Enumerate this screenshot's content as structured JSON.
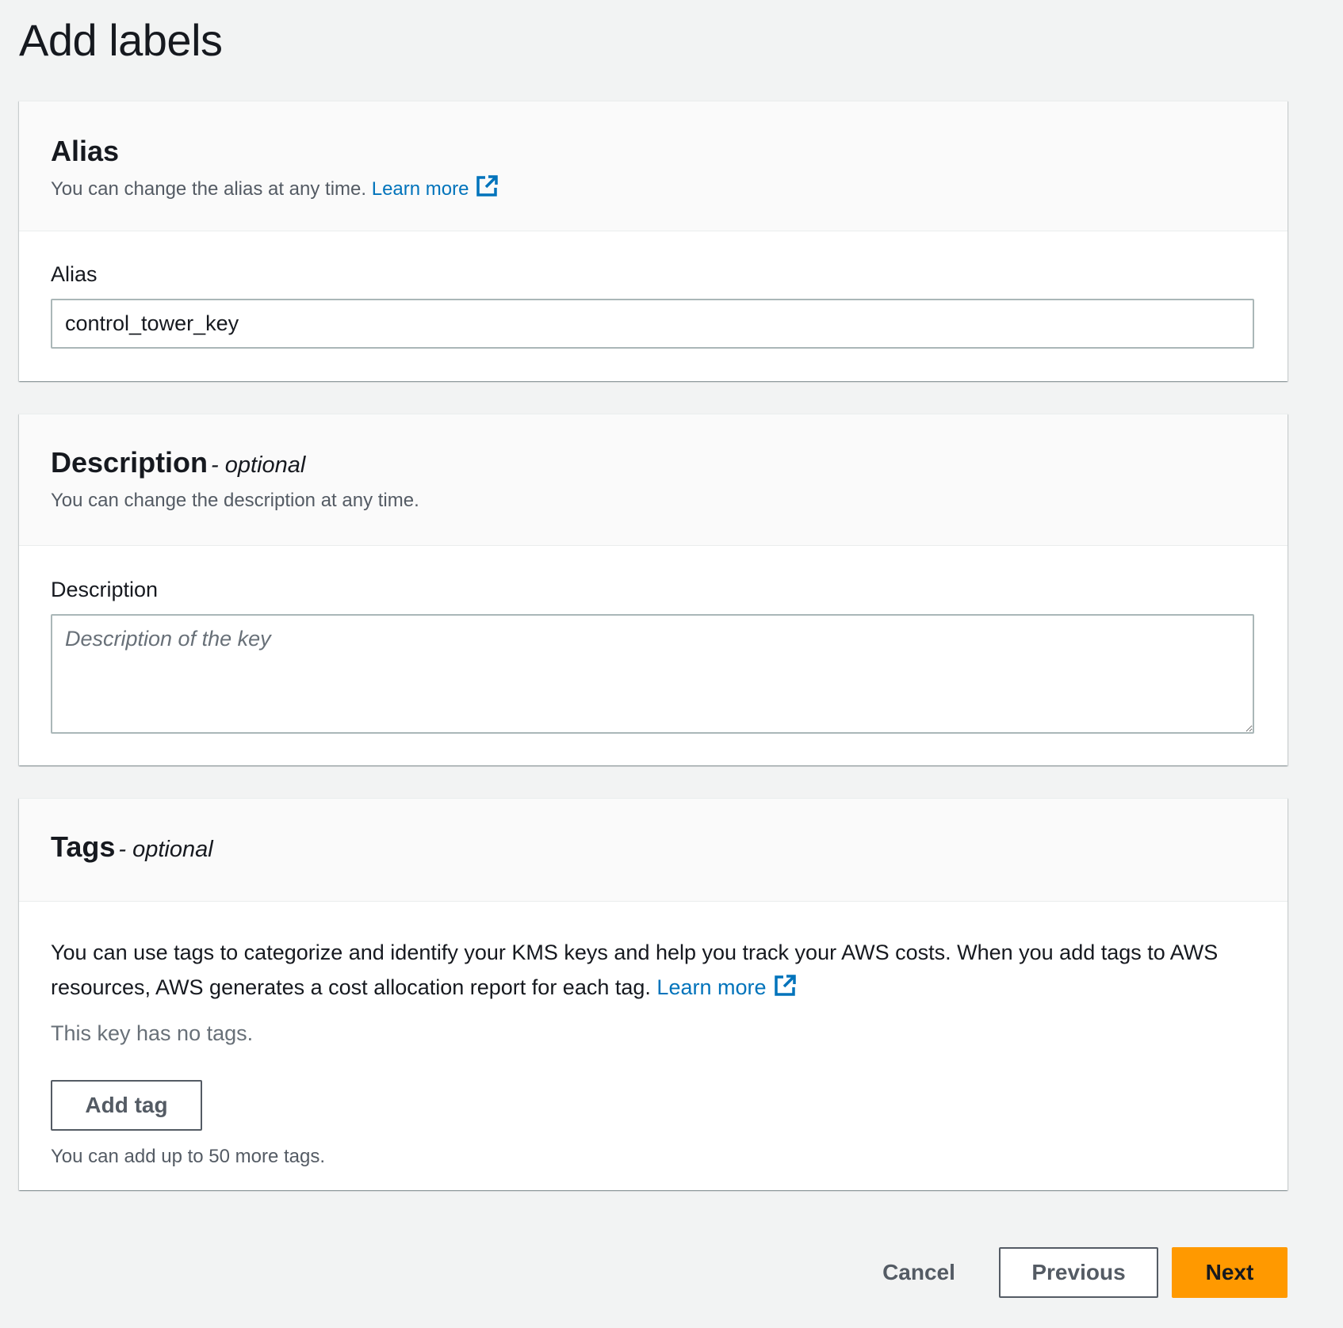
{
  "page": {
    "title": "Add labels"
  },
  "alias_section": {
    "header": "Alias",
    "description": "You can change the alias at any time.",
    "learn_more": "Learn more",
    "field_label": "Alias",
    "field_value": "control_tower_key"
  },
  "description_section": {
    "header": "Description",
    "optional": "- optional",
    "description": "You can change the description at any time.",
    "field_label": "Description",
    "field_placeholder": "Description of the key",
    "field_value": ""
  },
  "tags_section": {
    "header": "Tags",
    "optional": "- optional",
    "body_text": "You can use tags to categorize and identify your KMS keys and help you track your AWS costs. When you add tags to AWS resources, AWS generates a cost allocation report for each tag.",
    "learn_more": "Learn more",
    "empty_text": "This key has no tags.",
    "add_tag_label": "Add tag",
    "limit_text": "You can add up to 50 more tags."
  },
  "footer": {
    "cancel_label": "Cancel",
    "previous_label": "Previous",
    "next_label": "Next"
  },
  "colors": {
    "link": "#0073bb",
    "primary_button": "#ff9900",
    "page_background": "#f2f3f3",
    "header_background": "#fafafa"
  },
  "icons": {
    "external_link": "external-link-icon"
  }
}
